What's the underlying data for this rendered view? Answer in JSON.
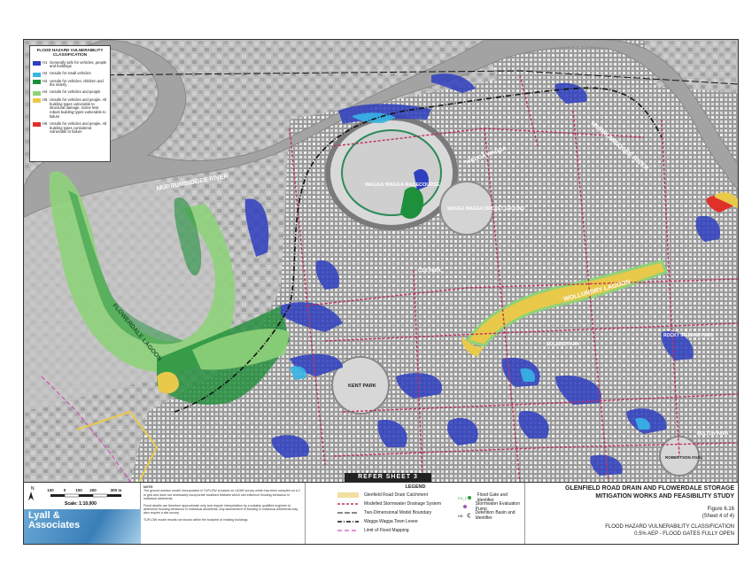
{
  "hazard_legend": {
    "title": "FLOOD HAZARD VULNERABILITY CLASSIFICATION",
    "classes": [
      {
        "code": "H1",
        "color": "#2f3fc0",
        "description": "Generally safe for vehicles, people and buildings"
      },
      {
        "code": "H2",
        "color": "#36b5e6",
        "description": "Unsafe for small vehicles"
      },
      {
        "code": "H3",
        "color": "#1e8f3a",
        "description": "Unsafe for vehicles, children and the elderly"
      },
      {
        "code": "H4",
        "color": "#8fd27a",
        "description": "Unsafe for vehicles and people"
      },
      {
        "code": "H5",
        "color": "#e8c94a",
        "description": "Unsafe for vehicles and people. All building types vulnerable to structural damage. Some less robust building types vulnerable to failure"
      },
      {
        "code": "H6",
        "color": "#e0302a",
        "description": "Unsafe for vehicles and people. All building types considered vulnerable to failure"
      }
    ]
  },
  "map_labels": {
    "murrumbidgee_river_west": "MURRUMBIDGEE RIVER",
    "murrumbidgee_river_east": "MURRUMBIDGEE RIVER",
    "flowerdale_lagoon": "FLOWERDALE LAGOON",
    "wollundry_lagoon": "WOLLUNDRY LAGOON",
    "racecourse": "WAGGA WAGGA RACECOURSE",
    "cricket_ground": "WAGGA WAGGA CRICKET GROUND",
    "wagga_wagga": "WAGGA WAGGA",
    "cox_park": "COX PARK",
    "kent_park": "KENT PARK",
    "bolton_park": "BOLTON PARK",
    "robertson_oval": "ROBERTSON OVAL",
    "collins_park": "COLLINS PARK",
    "rocky_ireland_park": "ROCKY IRELAND PARK",
    "refer_sheet": "REFER SHEET 3"
  },
  "scale": {
    "ticks": [
      "100",
      "0",
      "100",
      "200",
      "300 m"
    ],
    "text": "Scale: 1:10,000",
    "north": "N"
  },
  "logo": {
    "line1": "Lyall &",
    "line2": "Associates"
  },
  "note": {
    "heading": "NOTE:",
    "paragraphs": [
      "The ground surface model incorporated in TUFLOW is based on LiDAR survey which has been sampled on a 2 m grid and does not necessarily incorporate localised features which can influence flooding behaviour in individual allotments.",
      "Flood depths are therefore approximate only and require interpretation by a suitably qualified engineer to determine flooding behaviour in individual allotments. Any assessment of flooding in individual allotments may also require a site survey.",
      "TUFLOW model results not shown within the footprint of existing buildings."
    ]
  },
  "legend": {
    "title": "LEGEND",
    "items": [
      {
        "label": "Glenfield Road Drain Catchment",
        "color": "#f2dfa0"
      },
      {
        "label": "Modelled Stormwater Drainage System",
        "color": "#c0305a"
      },
      {
        "label": "Two-Dimensional Model Boundary",
        "color": "#111111"
      },
      {
        "label": "Wagga Wagga Town Levee",
        "color": "#111111"
      },
      {
        "label": "Limit of Flood Mapping",
        "color": "#d050c0"
      },
      {
        "label": "Flood Gate and Identifier",
        "symbol": "FG_1",
        "color": "#2e9a3a"
      },
      {
        "label": "Stormwater Evaluation Pump",
        "color": "#9b59b6"
      },
      {
        "label": "Detention Basin and Identifier",
        "symbol": "DB",
        "color": "#222222"
      }
    ]
  },
  "title_block": {
    "title_line1": "GLENFIELD ROAD DRAIN AND FLOWERDALE STORAGE",
    "title_line2": "MITIGATION WORKS AND FEASIBILITY STUDY",
    "figure": "Figure 6.16",
    "sheet": "(Sheet 4 of 4)",
    "caption_line1": "FLOOD HAZARD VULNERABILITY CLASSIFICATION",
    "caption_line2": "0.5% AEP - FLOOD GATES FULLY OPEN"
  }
}
